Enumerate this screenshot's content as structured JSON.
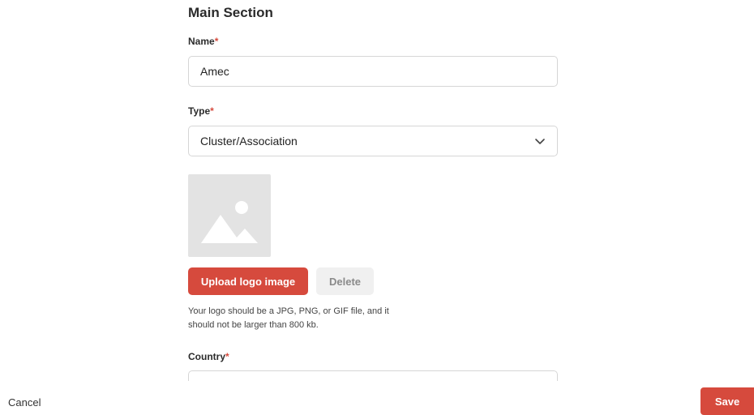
{
  "section": {
    "title": "Main Section"
  },
  "fields": {
    "name": {
      "label": "Name",
      "required_mark": "*",
      "value": "Amec"
    },
    "type": {
      "label": "Type",
      "required_mark": "*",
      "selected": "Cluster/Association"
    },
    "country": {
      "label": "Country",
      "required_mark": "*",
      "value": ""
    }
  },
  "logo": {
    "placeholder_icon": "image-placeholder-icon",
    "upload_label": "Upload logo image",
    "delete_label": "Delete",
    "hint_line1": "Your logo should be a JPG, PNG, or GIF file, and it",
    "hint_line2": "should not be larger than 800 kb."
  },
  "footer": {
    "cancel_label": "Cancel",
    "save_label": "Save"
  },
  "colors": {
    "accent": "#d64a3d",
    "placeholder_bg": "#e3e3e3",
    "border": "#d6d6d6"
  }
}
